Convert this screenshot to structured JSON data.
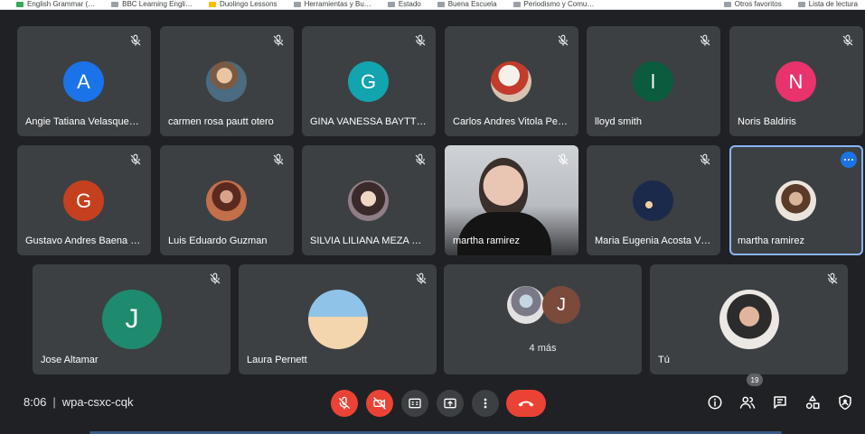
{
  "bookmarks": {
    "left": [
      "English Grammar (…",
      "BBC Learning Engli…",
      "Duolingo Lessons",
      "Herramientas y Bu…",
      "Estado",
      "Buena Escuela",
      "Periodismo y Comu…"
    ],
    "right": [
      "Otros favoritos",
      "Lista de lectura"
    ]
  },
  "tiles": {
    "row1": [
      {
        "name": "Angie Tatiana Velasquez …",
        "initial": "A",
        "color": "#1a73e8"
      },
      {
        "name": "carmen rosa pautt otero",
        "initial": ""
      },
      {
        "name": "GINA VANESSA BAYTTE…",
        "initial": "G",
        "color": "#12a4af"
      },
      {
        "name": "Carlos Andres Vitola Per…",
        "initial": ""
      },
      {
        "name": "lloyd smith",
        "initial": "l",
        "color": "#0b5b3f"
      },
      {
        "name": "Noris Baldiris",
        "initial": "N",
        "color": "#e8336d"
      }
    ],
    "row2": [
      {
        "name": "Gustavo Andres Baena …",
        "initial": "G",
        "color": "#c5401e"
      },
      {
        "name": "Luis Eduardo Guzman",
        "initial": ""
      },
      {
        "name": "SILVIA LILIANA MEZA D…",
        "initial": ""
      },
      {
        "name": "martha ramirez",
        "initial": ""
      },
      {
        "name": "Maria Eugenia Acosta Vil…",
        "initial": ""
      },
      {
        "name": "martha ramirez",
        "initial": ""
      }
    ],
    "row3": [
      {
        "name": "Jose Altamar",
        "initial": "J",
        "color": "#1e8a6e"
      },
      {
        "name": "Laura Pernett",
        "initial": ""
      },
      {
        "name": "4 más",
        "initial": "J",
        "color": "#7b4a3a"
      },
      {
        "name": "Tú",
        "initial": ""
      }
    ]
  },
  "bottom": {
    "time": "8:06",
    "separator": "|",
    "meeting_code": "wpa-csxc-cqk",
    "participants_count": "19"
  },
  "icons": {
    "mic": "mic-off-icon",
    "cam": "camera-off-icon",
    "cc": "captions-icon",
    "present": "present-icon",
    "more": "more-vert-icon",
    "end": "call-end-icon",
    "info": "info-icon",
    "people": "people-icon",
    "chat": "chat-icon",
    "activities": "activities-icon",
    "host": "host-controls-icon"
  },
  "colors": {
    "background": "#202124",
    "tile": "#3c4043",
    "danger": "#ea4335",
    "accent": "#8ab4f8"
  }
}
